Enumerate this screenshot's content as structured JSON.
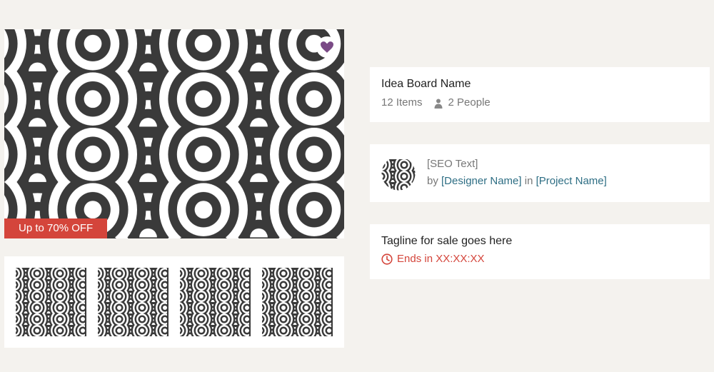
{
  "hero": {
    "badge_text": "Up to 70% OFF",
    "favorite_icon": "heart-icon",
    "favorite_color": "#7a4a86",
    "badge_color": "#d4453b",
    "pattern_dark": "#3a3a3a",
    "pattern_light": "#ffffff"
  },
  "thumbnails": {
    "count": 4
  },
  "board": {
    "name": "Idea Board Name",
    "items": "12 Items",
    "people": "2 People",
    "people_icon": "person-icon"
  },
  "product": {
    "seo_text": "[SEO Text]",
    "by": "by",
    "designer": "[Designer Name]",
    "in": "in",
    "project": "[Project Name]",
    "link_color": "#2e6e84"
  },
  "sale": {
    "tagline": "Tagline for sale goes here",
    "countdown": "Ends in XX:XX:XX",
    "clock_icon": "clock-icon"
  }
}
